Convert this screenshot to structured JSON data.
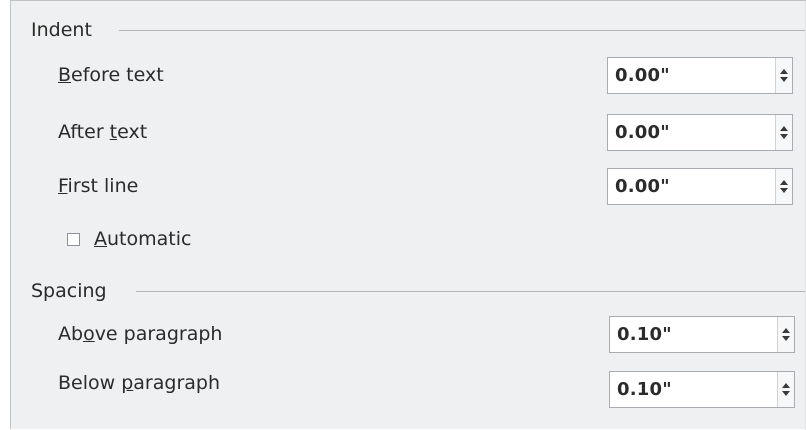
{
  "indent": {
    "heading": "Indent",
    "before_text": {
      "label_mnemonic": "B",
      "label_rest": "efore text",
      "value": "0.00\""
    },
    "after_text": {
      "label_pre": "After ",
      "label_mnemonic": "t",
      "label_rest": "ext",
      "value": "0.00\""
    },
    "first_line": {
      "label_mnemonic": "F",
      "label_rest": "irst line",
      "value": "0.00\""
    },
    "automatic": {
      "label_mnemonic": "A",
      "label_rest": "utomatic",
      "checked": false
    }
  },
  "spacing": {
    "heading": "Spacing",
    "above_paragraph": {
      "label_pre": "Ab",
      "label_mnemonic": "o",
      "label_rest": "ve paragraph",
      "value": "0.10\""
    },
    "below_paragraph": {
      "label_pre": "Below ",
      "label_mnemonic": "p",
      "label_rest": "aragraph",
      "value": "0.10\""
    }
  },
  "icons": {
    "spin_up": "arrow-up-icon",
    "spin_down": "arrow-down-icon"
  },
  "colors": {
    "panel_background": "#eff0f1",
    "field_background": "#ffffff",
    "border": "#a9adb1",
    "text": "#2b2b2b"
  }
}
